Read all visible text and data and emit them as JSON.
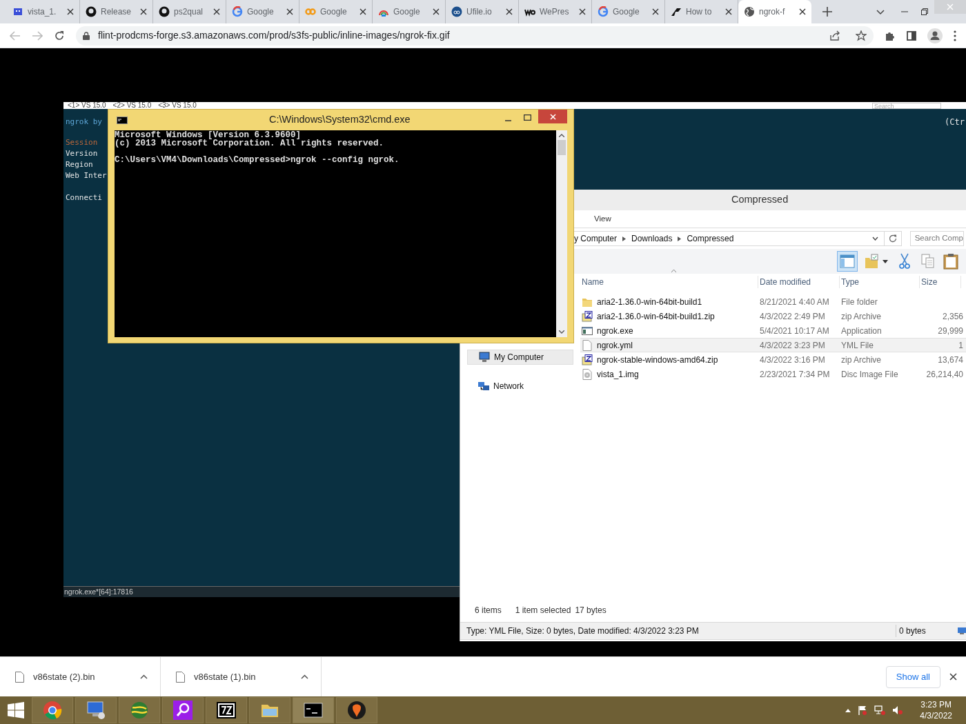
{
  "browser": {
    "tabs": [
      {
        "title": "vista_1.",
        "kind": "pixel",
        "selected": false
      },
      {
        "title": "Release",
        "kind": "github",
        "selected": false
      },
      {
        "title": "ps2qual",
        "kind": "github",
        "selected": false
      },
      {
        "title": "Google",
        "kind": "google",
        "selected": false
      },
      {
        "title": "Google",
        "kind": "link",
        "selected": false
      },
      {
        "title": "Google",
        "kind": "rainbow",
        "selected": false
      },
      {
        "title": "Ufile.io",
        "kind": "ufile",
        "selected": false
      },
      {
        "title": "WePres",
        "kind": "we",
        "selected": false
      },
      {
        "title": "Google",
        "kind": "google",
        "selected": false
      },
      {
        "title": "How to",
        "kind": "swoosh",
        "selected": false
      },
      {
        "title": "ngrok-f",
        "kind": "globe",
        "selected": true
      }
    ],
    "url": "flint-prodcms-forge.s3.amazonaws.com/prod/s3fs-public/inline-images/ngrok-fix.gif"
  },
  "image": {
    "vs_tabs": [
      "<1> VS 15.0",
      "<2> VS 15.0",
      "<3> VS 15.0"
    ],
    "search_placeholder": "Search",
    "console": {
      "title": "ngrok by",
      "lines": [
        {
          "text": "Session",
          "kind": "heading"
        },
        {
          "text": "Version",
          "kind": "label"
        },
        {
          "text": "Region",
          "kind": "label"
        },
        {
          "text": "Web Inter",
          "kind": "label"
        },
        {
          "text": "Connecti",
          "kind": "gap"
        }
      ],
      "hint": "(Ctr",
      "status": "ngrok.exe*[64]:17816"
    },
    "cmd": {
      "title": "C:\\Windows\\System32\\cmd.exe",
      "lines": [
        {
          "text": "Microsoft Windows [Version 6.3.9600]",
          "kind": "output"
        },
        {
          "text": "(c) 2013 Microsoft Corporation. All rights reserved.",
          "kind": "output"
        },
        {
          "text": "C:\\Users\\VM4\\Downloads\\Compressed>ngrok --config ngrok.",
          "kind": "prompt"
        }
      ]
    },
    "explorer": {
      "title": "Compressed",
      "ribbon_tabs": [
        "View"
      ],
      "breadcrumb": [
        "y Computer",
        "Downloads",
        "Compressed"
      ],
      "search_placeholder": "Search Comp",
      "columns": [
        "Name",
        "Date modified",
        "Type",
        "Size"
      ],
      "rows": [
        {
          "name": "aria2-1.36.0-win-64bit-build1",
          "date": "8/21/2021 4:40 AM",
          "type": "File folder",
          "kind": "folder",
          "selected": false
        },
        {
          "name": "aria2-1.36.0-win-64bit-build1.zip",
          "date": "4/3/2022 2:49 PM",
          "type": "zip Archive",
          "size": "2,356",
          "kind": "zip",
          "selected": false
        },
        {
          "name": "ngrok.exe",
          "date": "5/4/2021 10:17 AM",
          "type": "Application",
          "size": "29,999",
          "kind": "exe",
          "selected": false
        },
        {
          "name": "ngrok.yml",
          "date": "4/3/2022 3:23 PM",
          "type": "YML File",
          "size": "1",
          "kind": "file",
          "selected": true
        },
        {
          "name": "ngrok-stable-windows-amd64.zip",
          "date": "4/3/2022 3:16 PM",
          "type": "zip Archive",
          "size": "13,674",
          "kind": "zip",
          "selected": false
        },
        {
          "name": "vista_1.img",
          "date": "2/23/2021 7:34 PM",
          "type": "Disc Image File",
          "size": "26,214,40",
          "kind": "disc",
          "selected": false
        }
      ],
      "nav": [
        {
          "label": "My Computer",
          "kind": "computer",
          "selected": true
        },
        {
          "label": "Network",
          "kind": "network",
          "selected": false
        }
      ],
      "status": {
        "items": "6 items",
        "selection": "1 item selected",
        "bytes": "17 bytes"
      },
      "details": "Type: YML File, Size: 0 bytes, Date modified: 4/3/2022 3:23 PM",
      "details_size": "0 bytes"
    }
  },
  "downloads": {
    "items": [
      "v86state (2).bin",
      "v86state (1).bin"
    ],
    "show_all": "Show all"
  },
  "taskbar": {
    "apps": [
      {
        "kind": "chrome",
        "active": false
      },
      {
        "kind": "computer",
        "active": false
      },
      {
        "kind": "globe",
        "active": false
      },
      {
        "kind": "search",
        "active": false
      },
      {
        "kind": "sevenzip",
        "active": false
      },
      {
        "kind": "folder",
        "active": false
      },
      {
        "kind": "cmd",
        "active": true
      },
      {
        "kind": "qemu",
        "active": false
      }
    ],
    "time": "3:23 PM",
    "date": "4/3/2022"
  }
}
